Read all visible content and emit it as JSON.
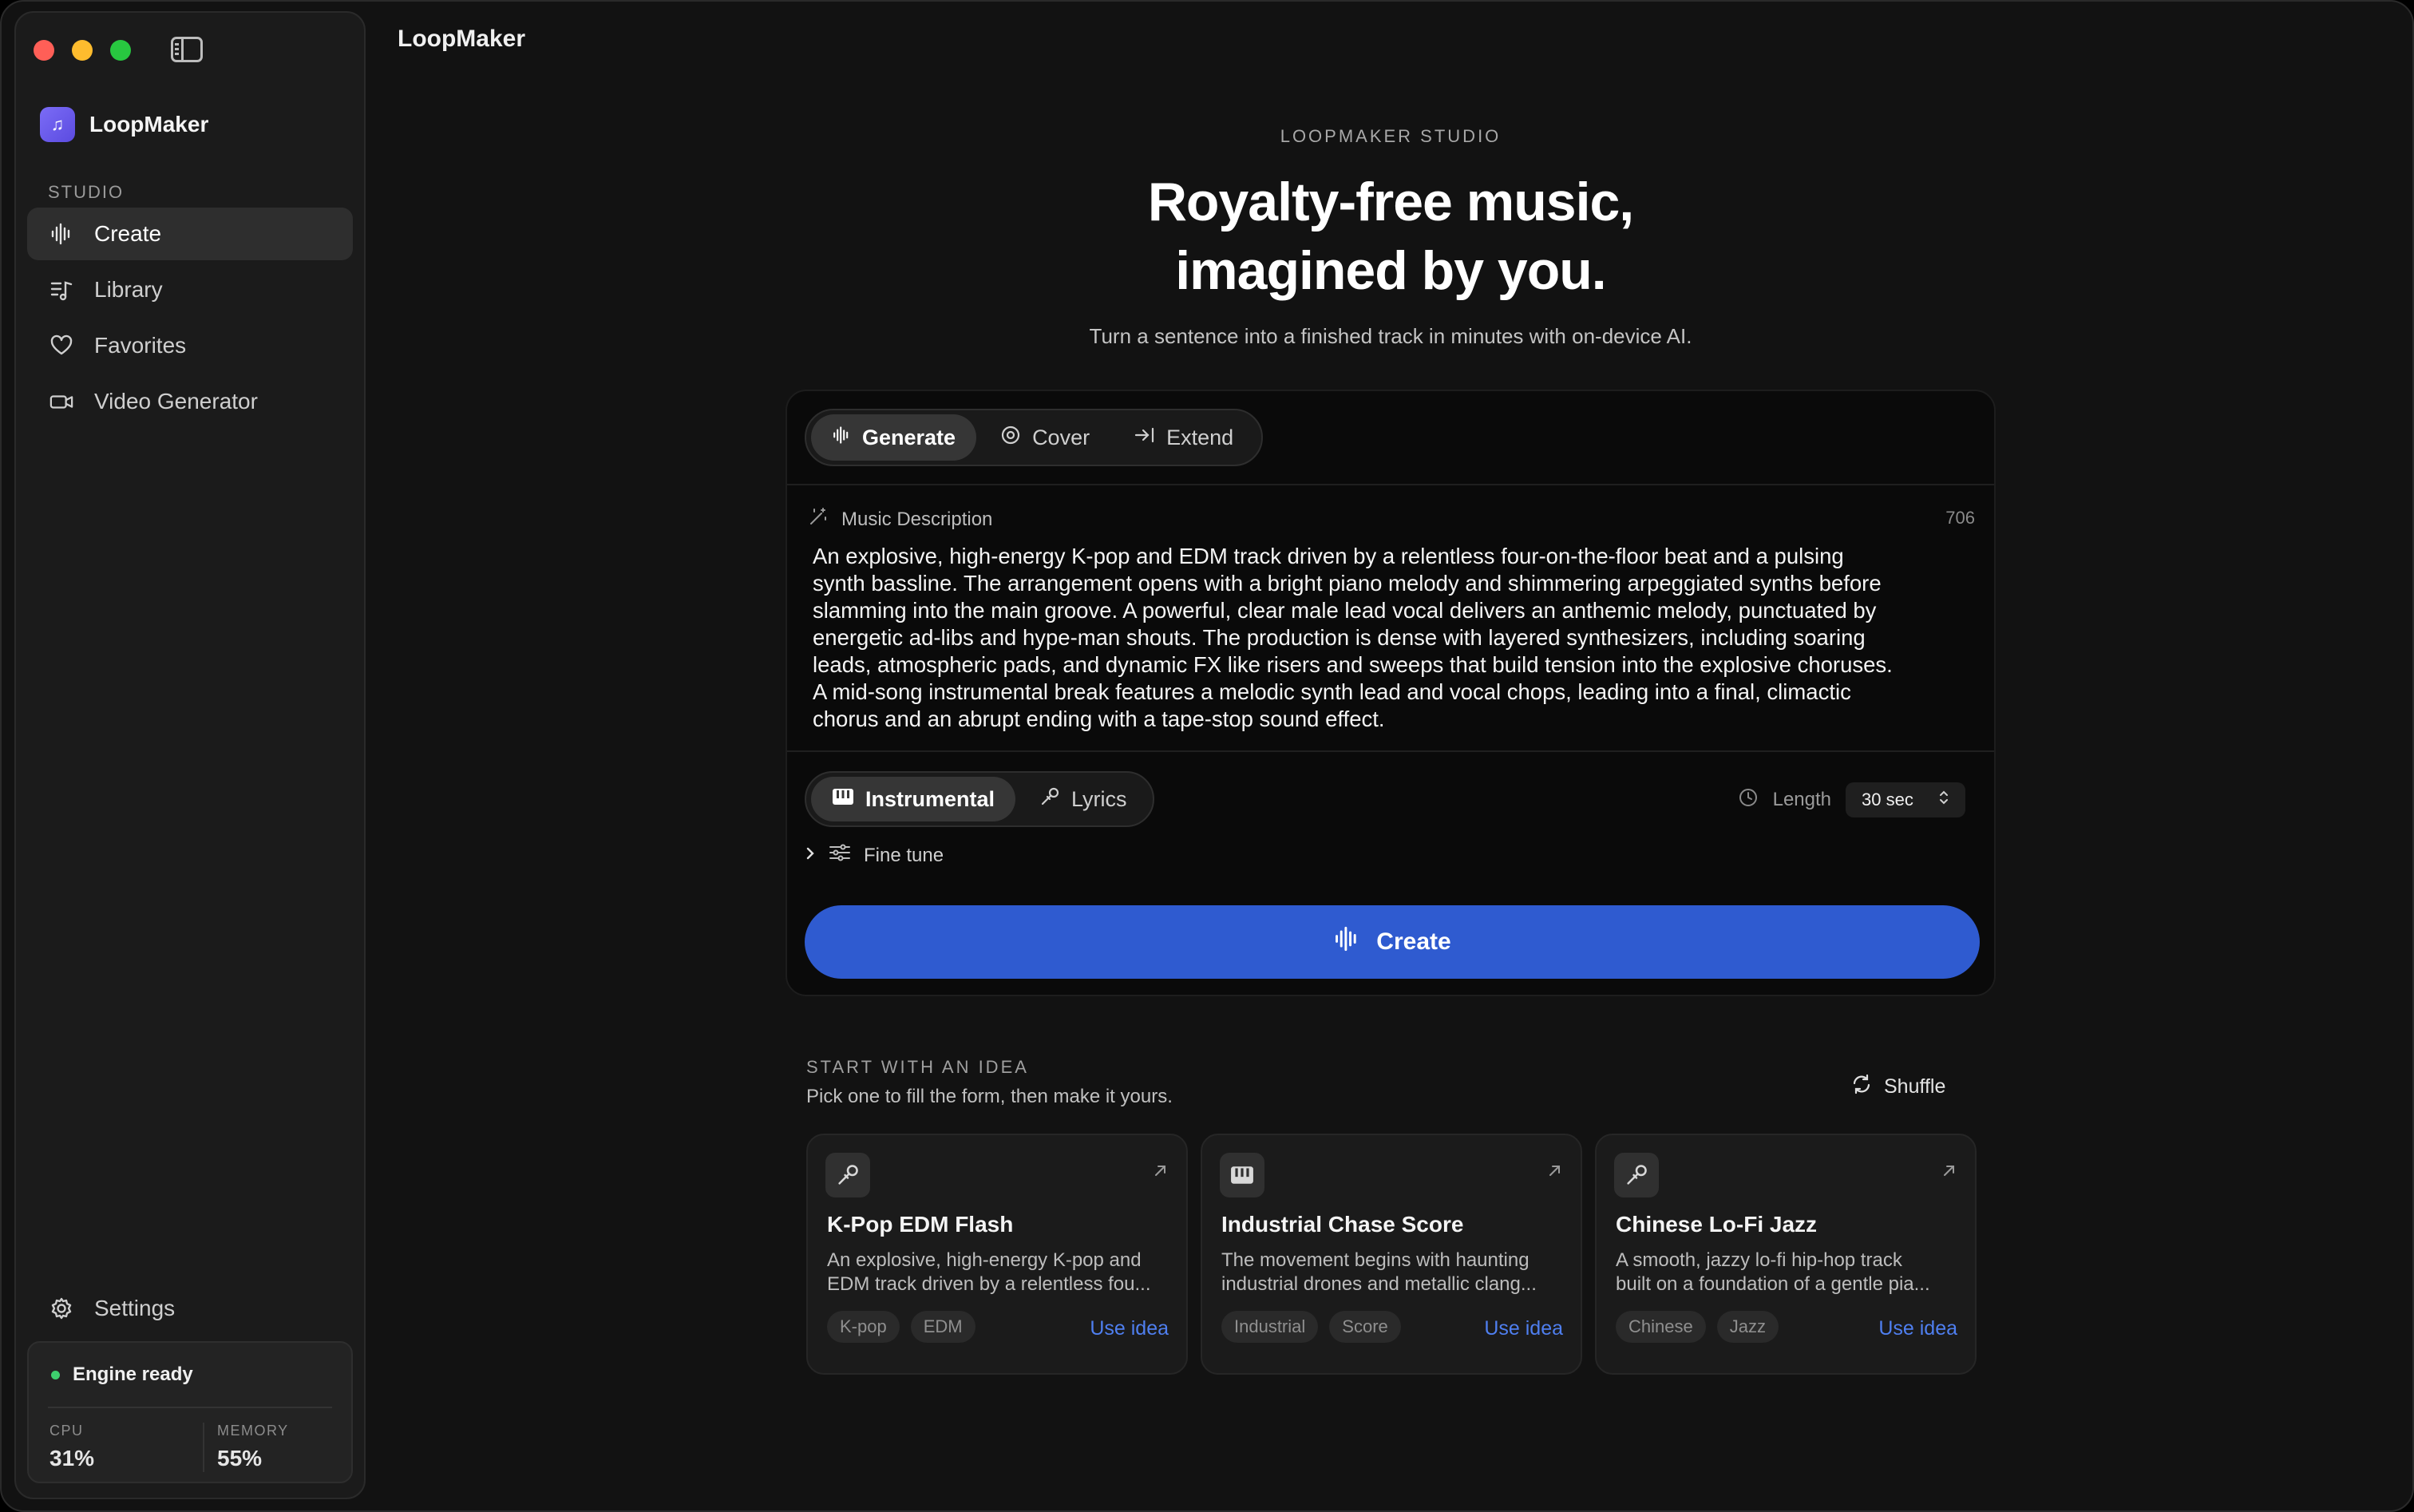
{
  "window": {
    "title": "LoopMaker",
    "traffic_colors": [
      "#ff5f57",
      "#febc2e",
      "#28c840"
    ]
  },
  "sidebar": {
    "brand": "LoopMaker",
    "section": "STUDIO",
    "items": [
      {
        "label": "Create",
        "icon": "waveform-icon",
        "active": true
      },
      {
        "label": "Library",
        "icon": "music-list-icon",
        "active": false
      },
      {
        "label": "Favorites",
        "icon": "heart-icon",
        "active": false
      },
      {
        "label": "Video Generator",
        "icon": "video-camera-icon",
        "active": false
      }
    ],
    "settings": "Settings",
    "engine": {
      "status": "Engine ready",
      "cpu_label": "CPU",
      "cpu_value": "31%",
      "memory_label": "MEMORY",
      "memory_value": "55%"
    }
  },
  "main": {
    "eyebrow": "LOOPMAKER STUDIO",
    "hero_line1": "Royalty-free music,",
    "hero_line2": "imagined by you.",
    "subtitle": "Turn a sentence into a finished track in minutes with on-device AI.",
    "modes": [
      "Generate",
      "Cover",
      "Extend"
    ],
    "description_label": "Music Description",
    "description_count": "706",
    "description_lines": [
      "An explosive, high-energy K-pop and EDM track driven by a relentless four-on-the-floor beat and a pulsing",
      "synth bassline. The arrangement opens with a bright piano melody and shimmering arpeggiated synths before",
      "slamming into the main groove. A powerful, clear male lead vocal delivers an anthemic melody, punctuated by",
      "energetic ad-libs and hype-man shouts. The production is dense with layered synthesizers, including soaring",
      "leads, atmospheric pads, and dynamic FX like risers and sweeps that build tension into the explosive choruses.",
      "A mid-song instrumental break features a melodic synth lead and vocal chops, leading into a final, climactic",
      "chorus and an abrupt ending with a tape-stop sound effect."
    ],
    "vocal_modes": [
      "Instrumental",
      "Lyrics"
    ],
    "length_label": "Length",
    "length_value": "30 sec",
    "fine_tune": "Fine tune",
    "create_button": "Create",
    "accent": "#2f5bd0"
  },
  "ideas": {
    "label": "START WITH AN IDEA",
    "subtitle": "Pick one to fill the form, then make it yours.",
    "shuffle": "Shuffle",
    "use_label": "Use idea",
    "cards": [
      {
        "title": "K-Pop EDM Flash",
        "icon": "microphone-icon",
        "line1": "An explosive, high-energy K-pop and",
        "line2": "EDM track driven by a relentless fou...",
        "tags": [
          "K-pop",
          "EDM"
        ]
      },
      {
        "title": "Industrial Chase Score",
        "icon": "piano-icon",
        "line1": "The movement begins with haunting",
        "line2": "industrial drones and metallic clang...",
        "tags": [
          "Industrial",
          "Score"
        ]
      },
      {
        "title": "Chinese Lo-Fi Jazz",
        "icon": "microphone-icon",
        "line1": "A smooth, jazzy lo-fi hip-hop track",
        "line2": "built on a foundation of a gentle pia...",
        "tags": [
          "Chinese",
          "Jazz"
        ]
      }
    ]
  }
}
